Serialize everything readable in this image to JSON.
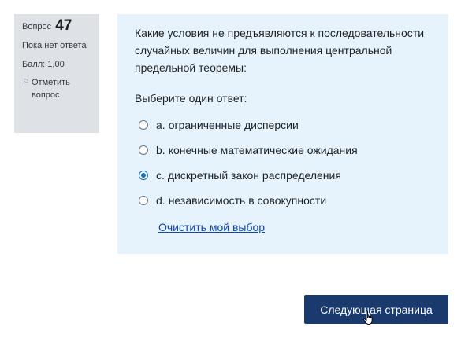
{
  "info": {
    "question_label": "Вопрос",
    "question_number": "47",
    "state": "Пока нет ответа",
    "grade": "Балл: 1,00",
    "flag_label": "Отметить вопрос"
  },
  "question": {
    "text": "Какие условия не предъявляются к последовательности случайных величин для выполнения центральной предельной теоремы:",
    "prompt": "Выберите один ответ:",
    "options": [
      {
        "letter": "a.",
        "text": "ограниченные дисперсии",
        "checked": false
      },
      {
        "letter": "b.",
        "text": "конечные математические ожидания",
        "checked": false
      },
      {
        "letter": "c.",
        "text": "дискретный закон распределения",
        "checked": true
      },
      {
        "letter": "d.",
        "text": "независимость в совокупности",
        "checked": false
      }
    ],
    "clear_label": "Очистить мой выбор"
  },
  "nav": {
    "next_label": "Следующая страница"
  },
  "colors": {
    "info_bg": "#dee2e6",
    "content_bg": "#e7f3fc",
    "accent": "#0f6cbf",
    "button_bg": "#1a3a6e"
  }
}
